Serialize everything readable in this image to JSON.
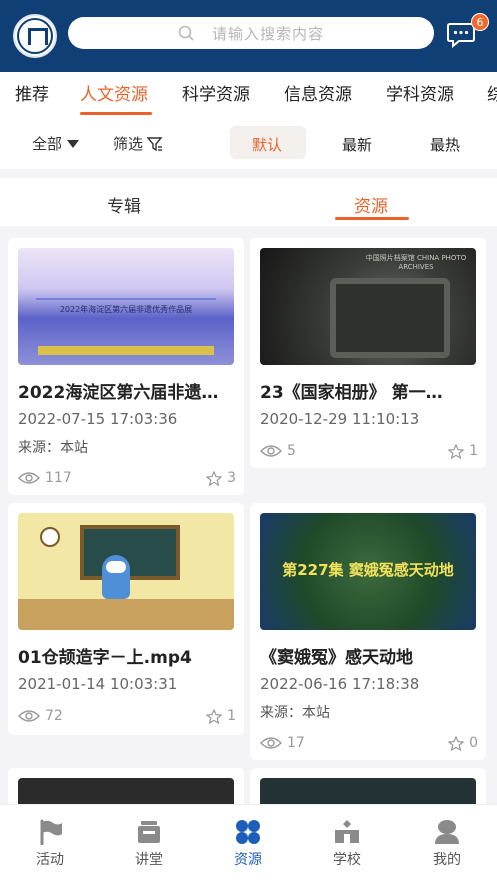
{
  "header": {
    "search_placeholder": "请输入搜索内容",
    "message_badge": "6"
  },
  "categories": [
    {
      "label": "推荐",
      "active": false
    },
    {
      "label": "人文资源",
      "active": true
    },
    {
      "label": "科学资源",
      "active": false
    },
    {
      "label": "信息资源",
      "active": false
    },
    {
      "label": "学科资源",
      "active": false
    },
    {
      "label": "综",
      "active": false
    }
  ],
  "filters": {
    "all_label": "全部",
    "filter_label": "筛选",
    "sorts": [
      {
        "label": "默认",
        "active": true
      },
      {
        "label": "最新",
        "active": false
      },
      {
        "label": "最热",
        "active": false
      }
    ]
  },
  "tabs": [
    {
      "label": "专辑",
      "active": false
    },
    {
      "label": "资源",
      "active": true
    }
  ],
  "cards": [
    {
      "title": "2022海淀区第六届非遗…",
      "date": "2022-07-15 17:03:36",
      "source": "来源：本站",
      "views": "117",
      "stars": "3",
      "thumb_text": "2022年海淀区第六届非遗优秀作品展"
    },
    {
      "title": "23《国家相册》 第一…",
      "date": "2020-12-29 11:10:13",
      "source": "",
      "views": "5",
      "stars": "1",
      "thumb_text": "中国照片档案馆 CHINA PHOTO ARCHIVES"
    },
    {
      "title": "01仓颉造字－上.mp4",
      "date": "2021-01-14 10:03:31",
      "source": "",
      "views": "72",
      "stars": "1",
      "thumb_text": ""
    },
    {
      "title": "《窦娥冤》感天动地",
      "date": "2022-06-16 17:18:38",
      "source": "来源：本站",
      "views": "17",
      "stars": "0",
      "thumb_text": "第227集 窦娥冤感天动地"
    }
  ],
  "tabbar": [
    {
      "label": "活动",
      "icon": "flag-icon",
      "active": false
    },
    {
      "label": "讲堂",
      "icon": "podium-icon",
      "active": false
    },
    {
      "label": "资源",
      "icon": "grid-icon",
      "active": true
    },
    {
      "label": "学校",
      "icon": "school-icon",
      "active": false
    },
    {
      "label": "我的",
      "icon": "user-icon",
      "active": false
    }
  ],
  "colors": {
    "brand": "#0f3f74",
    "accent": "#e8632b",
    "active_tab": "#1d5fb8"
  }
}
